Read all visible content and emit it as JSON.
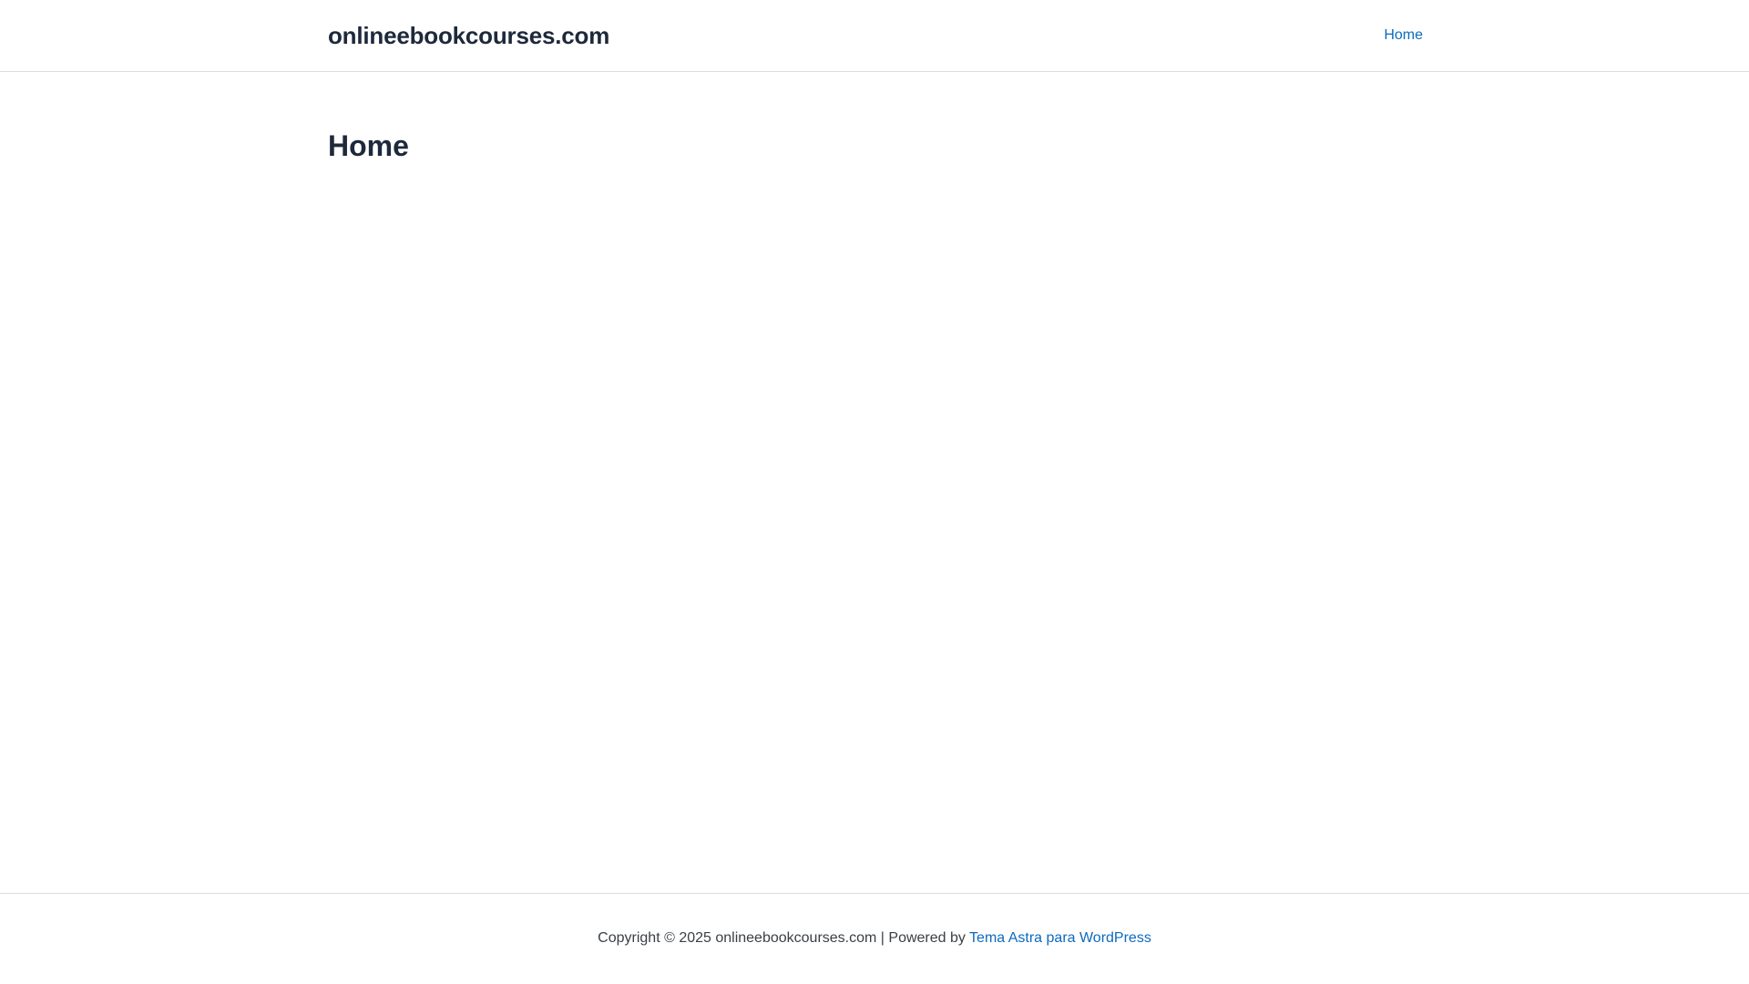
{
  "header": {
    "site_title": "onlineebookcourses.com",
    "nav": [
      {
        "label": "Home"
      }
    ]
  },
  "main": {
    "page_title": "Home"
  },
  "footer": {
    "copyright_text": "Copyright © 2025 onlineebookcourses.com | Powered by ",
    "theme_link_label": "Tema Astra para WordPress"
  },
  "colors": {
    "text": "#1e293b",
    "link": "#0b6bbf",
    "border": "#dadde1",
    "background": "#ffffff"
  }
}
